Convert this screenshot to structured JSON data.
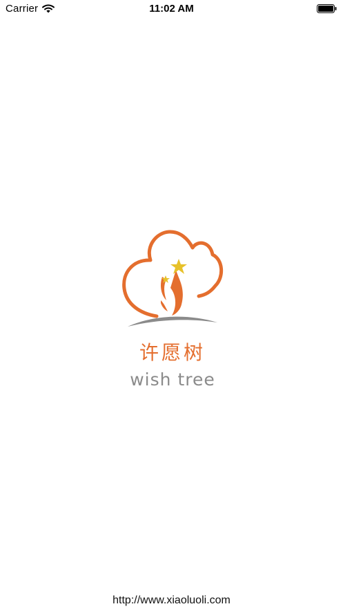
{
  "status_bar": {
    "carrier": "Carrier",
    "time": "11:02 AM",
    "wifi_icon": "wifi-icon",
    "battery_icon": "battery-full-icon"
  },
  "splash": {
    "logo_icon": "wish-tree-logo-icon",
    "title_cn": "许愿树",
    "title_en": "wish tree"
  },
  "footer": {
    "url": "http://www.xiaoluoli.com"
  },
  "colors": {
    "background": "#ffffff",
    "brand_orange": "#e46e2e",
    "star_yellow": "#e7c12a",
    "text_gray": "#8b8b8b"
  }
}
